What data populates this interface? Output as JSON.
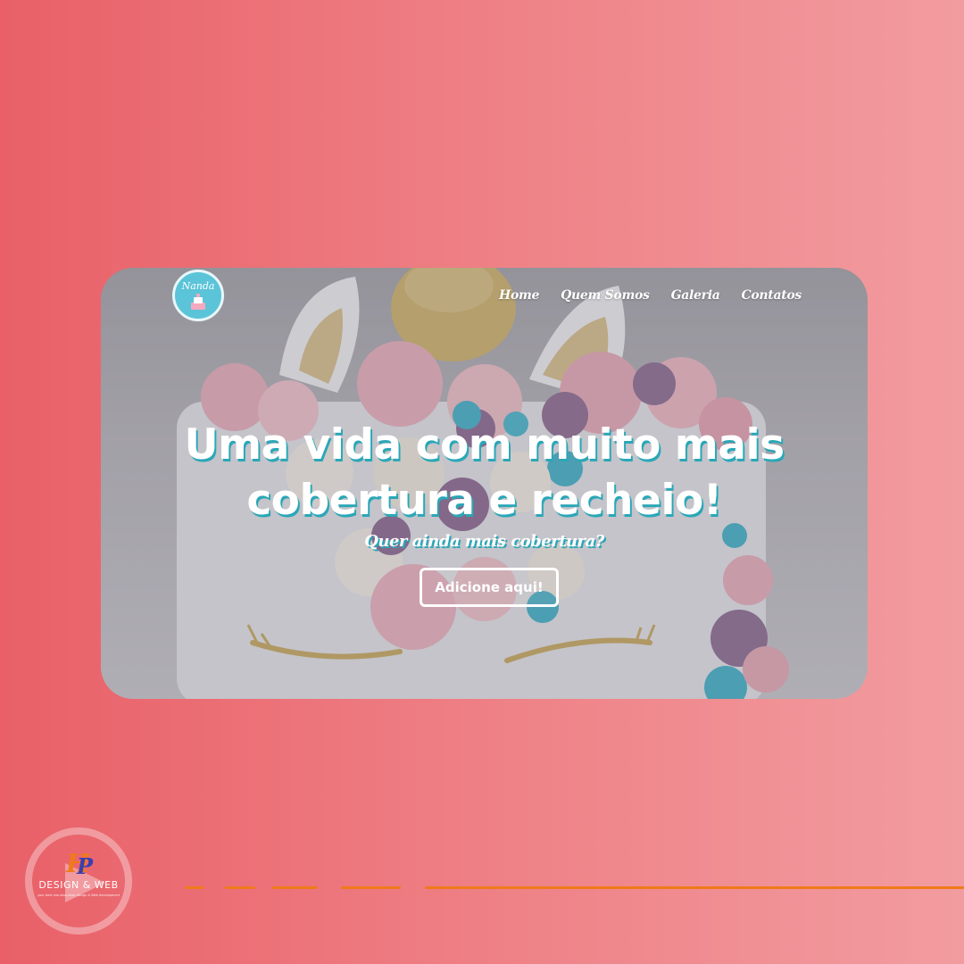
{
  "colors": {
    "background_start": "#e96068",
    "background_end": "#f29ca0",
    "headline_shadow": "#2aa7b7",
    "logo_bg": "#5bc4d8",
    "accent_line": "#f07a1a"
  },
  "header": {
    "logo_text": "Nanda",
    "logo_icon": "cake-icon",
    "nav": [
      {
        "label": "Home"
      },
      {
        "label": "Quem Somos"
      },
      {
        "label": "Galeria"
      },
      {
        "label": "Contatos"
      }
    ]
  },
  "hero": {
    "headline_line1": "Uma vida com muito mais",
    "headline_line2": "cobertura e recheio!",
    "subheadline": "Quer ainda mais cobertura?",
    "cta_label": "Adicione aqui!",
    "background_image": "unicorn-cake-image"
  },
  "brand": {
    "monogram": "HP",
    "name": "DESIGN & WEB",
    "tagline": "your best one-stop-shop design & Web development"
  }
}
